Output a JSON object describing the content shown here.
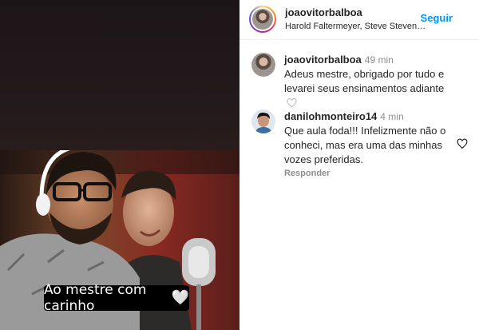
{
  "story": {
    "caption": "Ao mestre com carinho",
    "caption_heart_icon": "white-heart-emoji"
  },
  "post": {
    "username": "joaovitorbalboa",
    "follow_label": "Seguir",
    "audio": "Harold Faltermeyer, Steve Steven…"
  },
  "comments": [
    {
      "username": "joaovitorbalboa",
      "time": "49 min",
      "text": "Adeus mestre, obrigado por tudo e levarei seus ensinamentos adiante"
    },
    {
      "username": "danilohmonteiro14",
      "time": "4 min",
      "text": "Que aula foda!!! Infelizmente não o conheci, mas era uma das minhas vozes preferidas.",
      "reply_label": "Responder"
    }
  ],
  "colors": {
    "accent": "#0095f6",
    "muted": "#8e8e8e",
    "text": "#262626"
  }
}
